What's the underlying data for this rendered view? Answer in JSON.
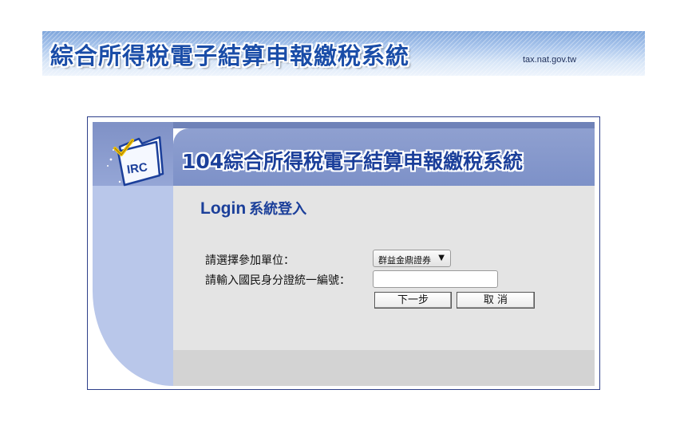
{
  "banner": {
    "title": "綜合所得稅電子結算申報繳稅系統",
    "url": "tax.nat.gov.tw"
  },
  "login_panel": {
    "system_title": "104綜合所得稅電子結算申報繳稅系統",
    "logo_text": "IRC",
    "heading_en": "Login",
    "heading_zh": "系統登入",
    "unit_label": "請選擇參加單位：",
    "unit_selected": "群益金鼎證券",
    "id_label": "請輸入國民身分證統一編號：",
    "id_value": "",
    "id_placeholder": "",
    "next_button": "下一步",
    "cancel_button": "取 消"
  },
  "icons": {
    "logo": "irc-folder-checkmark-icon",
    "dropdown": "chevron-down-icon"
  },
  "colors": {
    "title_blue": "#1b3f9a",
    "band_blue": "#7d91c8",
    "panel_light_blue": "#b9c7ea",
    "content_gray": "#e4e4e4",
    "frame_border": "#2d3f8a"
  }
}
